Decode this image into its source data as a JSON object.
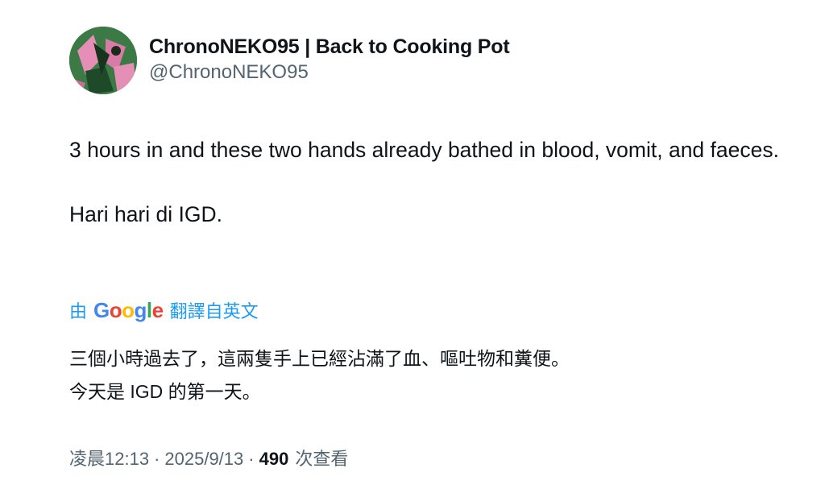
{
  "author": {
    "display_name": "ChronoNEKO95 | Back to Cooking Pot",
    "handle": "@ChronoNEKO95"
  },
  "tweet": {
    "paragraphs": [
      "3 hours in and these two hands already bathed in blood, vomit, and faeces.",
      "Hari hari di IGD."
    ]
  },
  "translation": {
    "prefix": "由",
    "provider": "Google",
    "suffix": "翻譯自英文",
    "lines": [
      "三個小時過去了，這兩隻手上已經沾滿了血、嘔吐物和糞便。",
      "今天是 IGD 的第一天。"
    ]
  },
  "meta": {
    "time": "凌晨12:13",
    "date": "2025/9/13",
    "separator": "·",
    "views_count": "490",
    "views_label": "次查看"
  },
  "colors": {
    "link": "#1d9bf0",
    "secondary_text": "#536471",
    "primary_text": "#0f1419",
    "avatar_green": "#2f6b3c",
    "avatar_pink": "#e58fb6"
  }
}
